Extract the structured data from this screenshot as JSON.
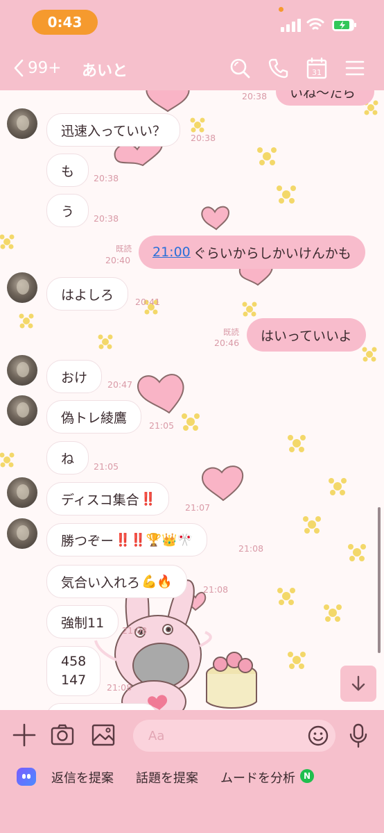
{
  "status_bar": {
    "time": "0:43"
  },
  "header": {
    "back_count": "99+",
    "chat_name": "あいと",
    "icons": [
      "search-icon",
      "phone-icon",
      "calendar-icon",
      "menu-icon"
    ],
    "calendar_day": "31"
  },
  "messages": [
    {
      "side": "out",
      "text": "いね〜たら",
      "time": "20:38"
    },
    {
      "side": "in",
      "text": "迅速入っていい？",
      "time": "20:38"
    },
    {
      "side": "in",
      "text": "も",
      "time": "20:38"
    },
    {
      "side": "in",
      "text": "う",
      "time": "20:38"
    },
    {
      "side": "out",
      "link": "21:00",
      "text": "ぐらいからしかいけんかも",
      "read": "既読",
      "time": "20:40"
    },
    {
      "side": "in",
      "text": "はよしろ",
      "time": "20:41"
    },
    {
      "side": "out",
      "text": "はいっていいよ",
      "read": "既読",
      "time": "20:46"
    },
    {
      "side": "in",
      "text": "おけ",
      "time": "20:47"
    },
    {
      "side": "in",
      "text": "偽トレ綾鷹",
      "time": "21:05"
    },
    {
      "side": "in",
      "text": "ね",
      "time": "21:05"
    },
    {
      "side": "in",
      "text": "ディスコ集合",
      "emoji": "‼️",
      "time": "21:07"
    },
    {
      "side": "in",
      "text": "勝つぞー",
      "emoji": "‼️‼️🏆👑🎌",
      "time": "21:08"
    },
    {
      "side": "in",
      "text": "気合い入れろ",
      "emoji": "💪🔥",
      "time": "21:08"
    },
    {
      "side": "in",
      "text": "強制11",
      "time": "21:08"
    },
    {
      "side": "in",
      "line1": "458",
      "line2": "147",
      "time": "21:08"
    }
  ],
  "input": {
    "placeholder": "Aa"
  },
  "suggestions": {
    "reply": "返信を提案",
    "topic": "話題を提案",
    "mood": "ムードを分析",
    "badge": "N"
  },
  "colors": {
    "theme_pink": "#f6c0cc",
    "outgoing_bubble": "#f8bccc",
    "status_time_bg": "#f59a2e",
    "link": "#2a6fd8"
  }
}
